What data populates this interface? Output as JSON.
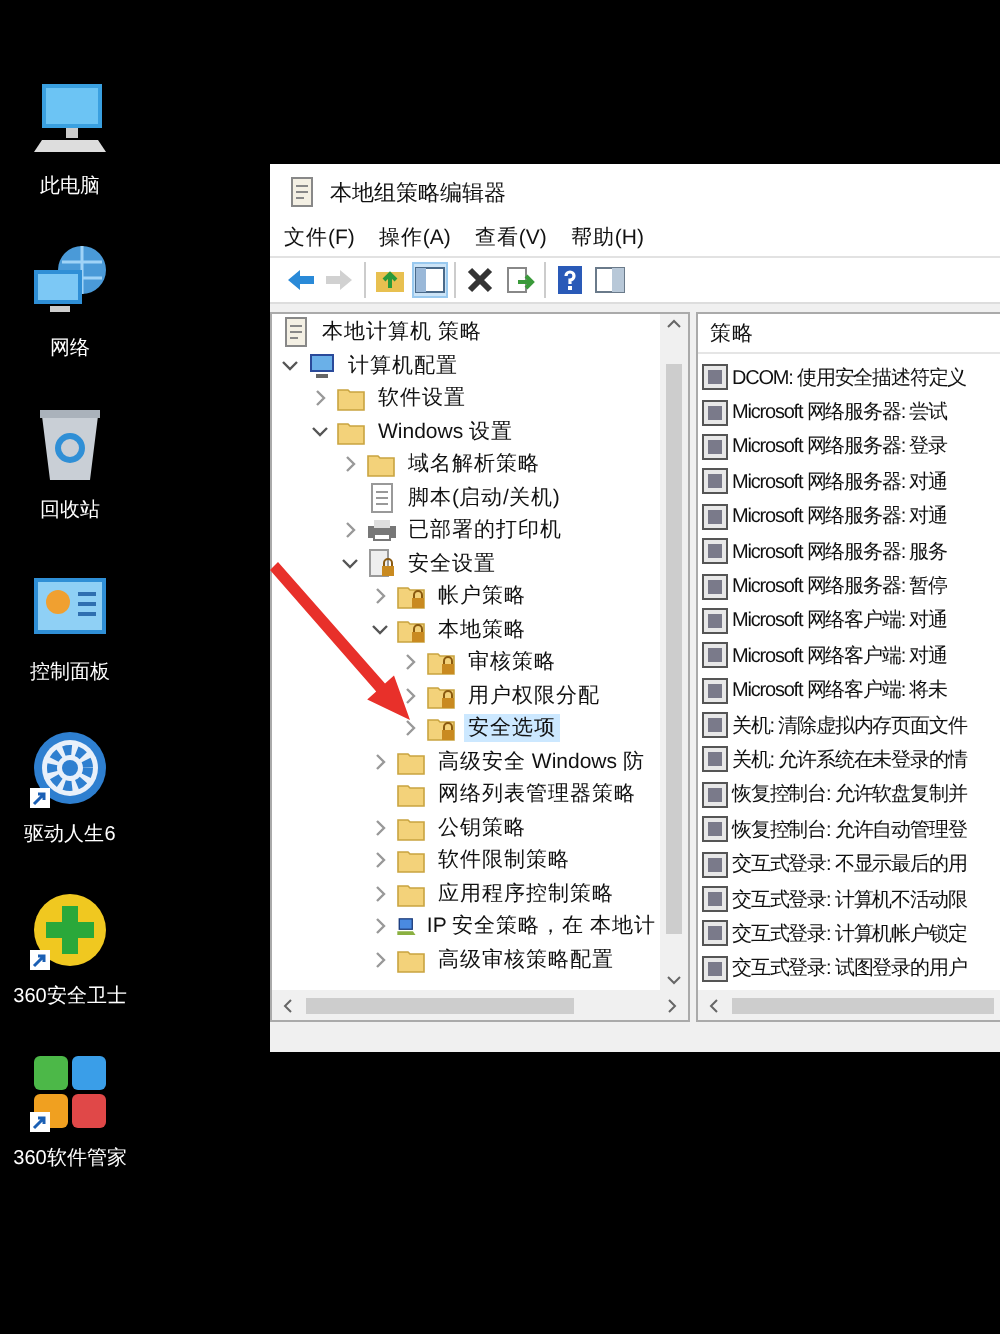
{
  "desktop_icons": [
    {
      "label": "此电脑",
      "kind": "computer",
      "shortcut": false
    },
    {
      "label": "网络",
      "kind": "network",
      "shortcut": false
    },
    {
      "label": "回收站",
      "kind": "recycle",
      "shortcut": false
    },
    {
      "label": "控制面板",
      "kind": "control",
      "shortcut": false
    },
    {
      "label": "驱动人生6",
      "kind": "gear",
      "shortcut": true
    },
    {
      "label": "360安全卫士",
      "kind": "plus",
      "shortcut": true
    },
    {
      "label": "360软件管家",
      "kind": "tiles",
      "shortcut": true
    }
  ],
  "window": {
    "title": "本地组策略编辑器"
  },
  "menu": [
    "文件(F)",
    "操作(A)",
    "查看(V)",
    "帮助(H)"
  ],
  "toolbar": {
    "groups": [
      [
        {
          "kind": "back",
          "disabled": false,
          "pressed": false
        },
        {
          "kind": "forward",
          "disabled": true,
          "pressed": false
        }
      ],
      [
        {
          "kind": "up",
          "disabled": false,
          "pressed": false
        },
        {
          "kind": "tree",
          "disabled": false,
          "pressed": true
        }
      ],
      [
        {
          "kind": "delete",
          "disabled": false,
          "pressed": false
        },
        {
          "kind": "export",
          "disabled": false,
          "pressed": false
        }
      ],
      [
        {
          "kind": "help",
          "disabled": false,
          "pressed": false
        },
        {
          "kind": "panel",
          "disabled": false,
          "pressed": false
        }
      ]
    ]
  },
  "tree": [
    {
      "label": "本地计算机 策略",
      "kind": "policy",
      "selected": false,
      "children": [
        {
          "label": "计算机配置",
          "kind": "computer",
          "expanded": true,
          "selected": false,
          "children": [
            {
              "label": "软件设置",
              "kind": "folder",
              "expanded": false,
              "selected": false
            },
            {
              "label": "Windows 设置",
              "kind": "folder",
              "expanded": true,
              "selected": false,
              "children": [
                {
                  "label": "域名解析策略",
                  "kind": "folder",
                  "expanded": false,
                  "selected": false
                },
                {
                  "label": "脚本(启动/关机)",
                  "kind": "script",
                  "selected": false
                },
                {
                  "label": "已部署的打印机",
                  "kind": "printer",
                  "expanded": false,
                  "selected": false
                },
                {
                  "label": "安全设置",
                  "kind": "security",
                  "expanded": true,
                  "selected": false,
                  "children": [
                    {
                      "label": "帐户策略",
                      "kind": "lockfolder",
                      "expanded": false,
                      "selected": false
                    },
                    {
                      "label": "本地策略",
                      "kind": "lockfolder",
                      "expanded": true,
                      "selected": false,
                      "children": [
                        {
                          "label": "审核策略",
                          "kind": "lockfolder",
                          "expanded": false,
                          "selected": false
                        },
                        {
                          "label": "用户权限分配",
                          "kind": "lockfolder",
                          "expanded": false,
                          "selected": false
                        },
                        {
                          "label": "安全选项",
                          "kind": "lockfolder",
                          "expanded": false,
                          "selected": true
                        }
                      ]
                    },
                    {
                      "label": "高级安全 Windows 防",
                      "kind": "folder",
                      "expanded": false,
                      "selected": false
                    },
                    {
                      "label": "网络列表管理器策略",
                      "kind": "folder",
                      "selected": false
                    },
                    {
                      "label": "公钥策略",
                      "kind": "folder",
                      "expanded": false,
                      "selected": false
                    },
                    {
                      "label": "软件限制策略",
                      "kind": "folder",
                      "expanded": false,
                      "selected": false
                    },
                    {
                      "label": "应用程序控制策略",
                      "kind": "folder",
                      "expanded": false,
                      "selected": false
                    },
                    {
                      "label": "IP 安全策略，在 本地计",
                      "kind": "ip",
                      "expanded": false,
                      "selected": false
                    },
                    {
                      "label": "高级审核策略配置",
                      "kind": "folder",
                      "expanded": false,
                      "selected": false
                    }
                  ]
                }
              ]
            }
          ]
        }
      ]
    }
  ],
  "list": {
    "column": "策略",
    "rows": [
      "DCOM: 使用安全描述符定义",
      "Microsoft 网络服务器: 尝试",
      "Microsoft 网络服务器: 登录",
      "Microsoft 网络服务器: 对通",
      "Microsoft 网络服务器: 对通",
      "Microsoft 网络服务器: 服务",
      "Microsoft 网络服务器: 暂停",
      "Microsoft 网络客户端: 对通",
      "Microsoft 网络客户端: 对通",
      "Microsoft 网络客户端: 将未",
      "关机: 清除虚拟内存页面文件",
      "关机: 允许系统在未登录的情",
      "恢复控制台: 允许软盘复制并",
      "恢复控制台: 允许自动管理登",
      "交互式登录: 不显示最后的用",
      "交互式登录: 计算机不活动限",
      "交互式登录: 计算机帐户锁定",
      "交互式登录: 试图登录的用户"
    ]
  }
}
